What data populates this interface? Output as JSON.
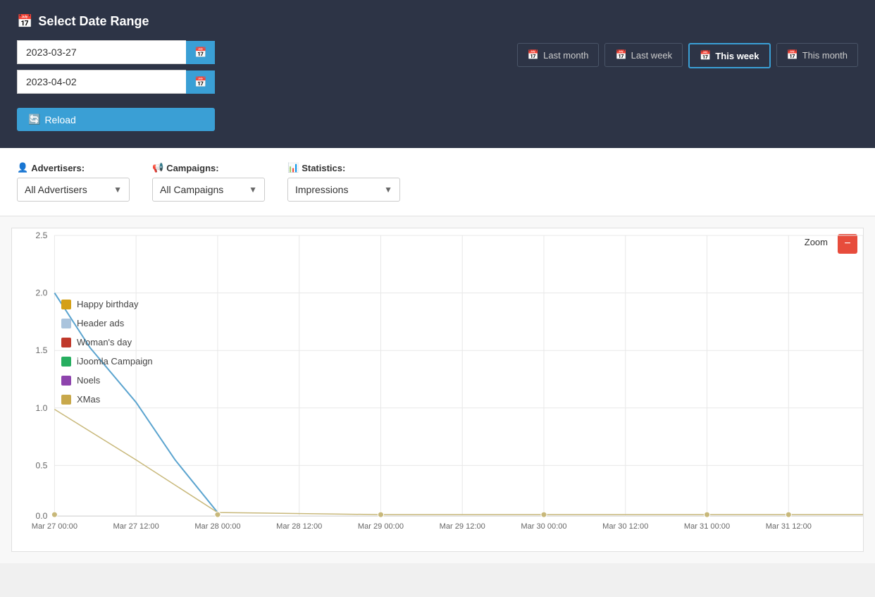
{
  "header": {
    "title": "Select Date Range",
    "title_icon": "📅",
    "start_date": "2023-03-27",
    "end_date": "2023-04-02",
    "calendar_icon": "📅",
    "reload_label": "Reload",
    "reload_icon": "🔄"
  },
  "quick_buttons": [
    {
      "id": "last-month",
      "label": "Last month",
      "active": false
    },
    {
      "id": "last-week",
      "label": "Last week",
      "active": false
    },
    {
      "id": "this-week",
      "label": "This week",
      "active": true
    },
    {
      "id": "this-month",
      "label": "This month",
      "active": false
    }
  ],
  "filters": {
    "advertisers_label": "Advertisers:",
    "advertisers_icon": "👤",
    "advertisers_value": "All Advertisers",
    "campaigns_label": "Campaigns:",
    "campaigns_icon": "📢",
    "campaigns_value": "All Campaigns",
    "statistics_label": "Statistics:",
    "statistics_icon": "📊",
    "statistics_value": "Impressions"
  },
  "chart": {
    "zoom_label": "Zoom",
    "zoom_minus": "−",
    "y_ticks": [
      "0.0",
      "0.5",
      "1.0",
      "1.5",
      "2.0",
      "2.5"
    ],
    "x_ticks": [
      "Mar 27 00:00",
      "Mar 27 12:00",
      "Mar 28 00:00",
      "Mar 28 12:00",
      "Mar 29 00:00",
      "Mar 29 12:00",
      "Mar 30 00:00",
      "Mar 30 12:00",
      "Mar 31 00:00",
      "Mar 31 12:00"
    ],
    "legend": [
      {
        "label": "Happy birthday",
        "color": "#d4a017"
      },
      {
        "label": "Header ads",
        "color": "#aac4dd"
      },
      {
        "label": "Woman's day",
        "color": "#c0392b"
      },
      {
        "label": "iJoomla Campaign",
        "color": "#27ae60"
      },
      {
        "label": "Noels",
        "color": "#8e44ad"
      },
      {
        "label": "XMas",
        "color": "#c8a84b"
      }
    ]
  }
}
